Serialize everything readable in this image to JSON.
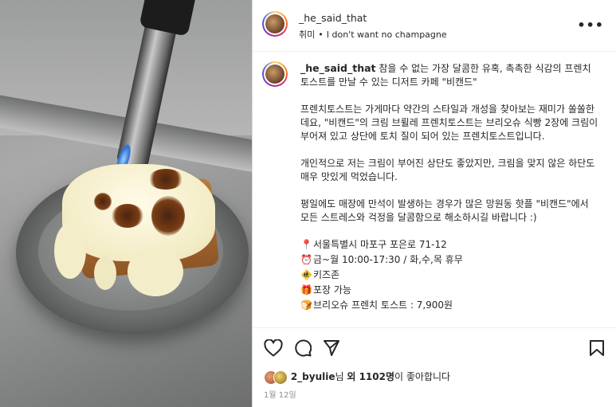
{
  "post": {
    "username": "_he_said_that",
    "location": "취미",
    "audio": "I don't want no champagne",
    "more_label": "•••"
  },
  "caption": {
    "username": "_he_said_that",
    "intro": "참을 수 없는 가장 달콤한 유혹, 촉촉한 식감의 프렌치토스트를 만날 수 있는 디저트 카페 \"비캔드\"",
    "para1": "프렌치토스트는 가게마다 약간의 스타일과 개성을 찾아보는 재미가 쏠쏠한데요, \"비캔드\"의 크림 브륄레 프렌치토스트는 브리오슈 식빵 2장에 크림이 부어져 있고 상단에 토치 질이 되어 있는 프렌치토스트입니다.",
    "para2": "개인적으로 저는 크림이 부어진 상단도 좋았지만, 크림을 맞지 않은 하단도 매우 맛있게 먹었습니다.",
    "para3": "평일에도 매장에 만석이 발생하는 경우가 많은 망원동 핫플 \"비캔드\"에서 모든 스트레스와 걱정을 달콤함으로 해소하시길 바랍니다 :)",
    "info": [
      {
        "icon": "📍",
        "icon_name": "pin-icon",
        "text": "서울특별시 마포구 포은로 71-12"
      },
      {
        "icon": "⏰",
        "icon_name": "alarm-clock-icon",
        "text": "금~월 10:00-17:30 / 화,수,목 휴무"
      },
      {
        "icon": "🚸",
        "icon_name": "children-crossing-icon",
        "text": "키즈존"
      },
      {
        "icon": "🎁",
        "icon_name": "gift-icon",
        "text": "포장 가능"
      },
      {
        "icon": "🍞",
        "icon_name": "bread-icon",
        "text": "브리오슈 프렌치 토스트 : 7,900원"
      }
    ]
  },
  "likes": {
    "user": "2_byulie",
    "prefix": "님 ",
    "count_label": "외 1102명",
    "suffix": "이 좋아합니다"
  },
  "date": "1월 12일",
  "colors": {
    "text": "#262626",
    "muted": "#8e8e8e",
    "border": "#dbdbdb"
  }
}
